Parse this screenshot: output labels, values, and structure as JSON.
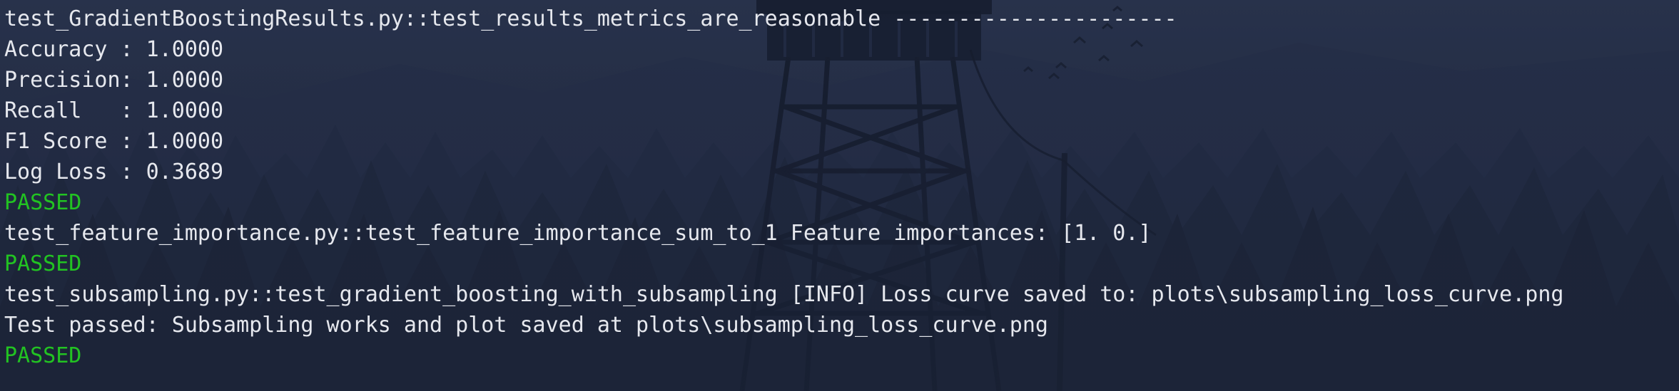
{
  "colors": {
    "terminal_text": "#e6e8ee",
    "passed_green": "#22c322",
    "background": "#253049"
  },
  "wallpaper": {
    "icon": "forest-fire-lookout-tower-wallpaper"
  },
  "terminal": {
    "lines": [
      {
        "text": "test_GradientBoostingResults.py::test_results_metrics_are_reasonable ----------------------",
        "kind": "normal"
      },
      {
        "text": "Accuracy : 1.0000",
        "kind": "normal"
      },
      {
        "text": "Precision: 1.0000",
        "kind": "normal"
      },
      {
        "text": "Recall   : 1.0000",
        "kind": "normal"
      },
      {
        "text": "F1 Score : 1.0000",
        "kind": "normal"
      },
      {
        "text": "Log Loss : 0.3689",
        "kind": "normal"
      },
      {
        "text": "PASSED",
        "kind": "pass"
      },
      {
        "text": "test_feature_importance.py::test_feature_importance_sum_to_1 Feature importances: [1. 0.]",
        "kind": "normal"
      },
      {
        "text": "PASSED",
        "kind": "pass"
      },
      {
        "text": "test_subsampling.py::test_gradient_boosting_with_subsampling [INFO] Loss curve saved to: plots\\subsampling_loss_curve.png",
        "kind": "normal"
      },
      {
        "text": "Test passed: Subsampling works and plot saved at plots\\subsampling_loss_curve.png",
        "kind": "normal"
      },
      {
        "text": "PASSED",
        "kind": "pass"
      }
    ]
  }
}
